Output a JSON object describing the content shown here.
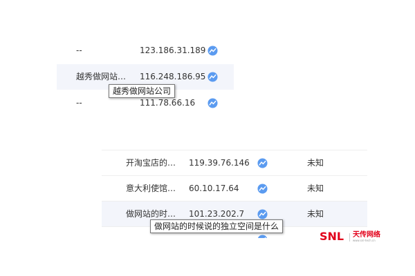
{
  "colors": {
    "accent": "#5b9bf0",
    "row_highlight": "#f3f5fb",
    "border": "#eeeeee",
    "watermark": "#e2001a"
  },
  "icons": {
    "trend": "trend-chart-icon"
  },
  "top_table": {
    "rows": [
      {
        "name": "--",
        "ip": "123.186.31.189"
      },
      {
        "name": "越秀做网站…",
        "ip": "116.248.186.95"
      },
      {
        "name": "--",
        "ip": "111.78.66.16"
      }
    ],
    "highlighted_row": 1,
    "tooltip": "越秀做网站公司"
  },
  "bottom_table": {
    "rows": [
      {
        "name": "开淘宝店的…",
        "ip": "119.39.76.146",
        "status": "未知"
      },
      {
        "name": "意大利使馆…",
        "ip": "60.10.17.64",
        "status": "未知"
      },
      {
        "name": "做网站的时…",
        "ip": "101.23.202.7",
        "status": "未知"
      },
      {
        "name": "ー ー — —",
        "ip": "",
        "status": ""
      }
    ],
    "highlighted_row": 2,
    "tooltip": "做网站的时候说的独立空间是什么"
  },
  "watermark": {
    "logo": "SNL",
    "text": "天传网络",
    "sub": "www.snl-tech.cn"
  }
}
